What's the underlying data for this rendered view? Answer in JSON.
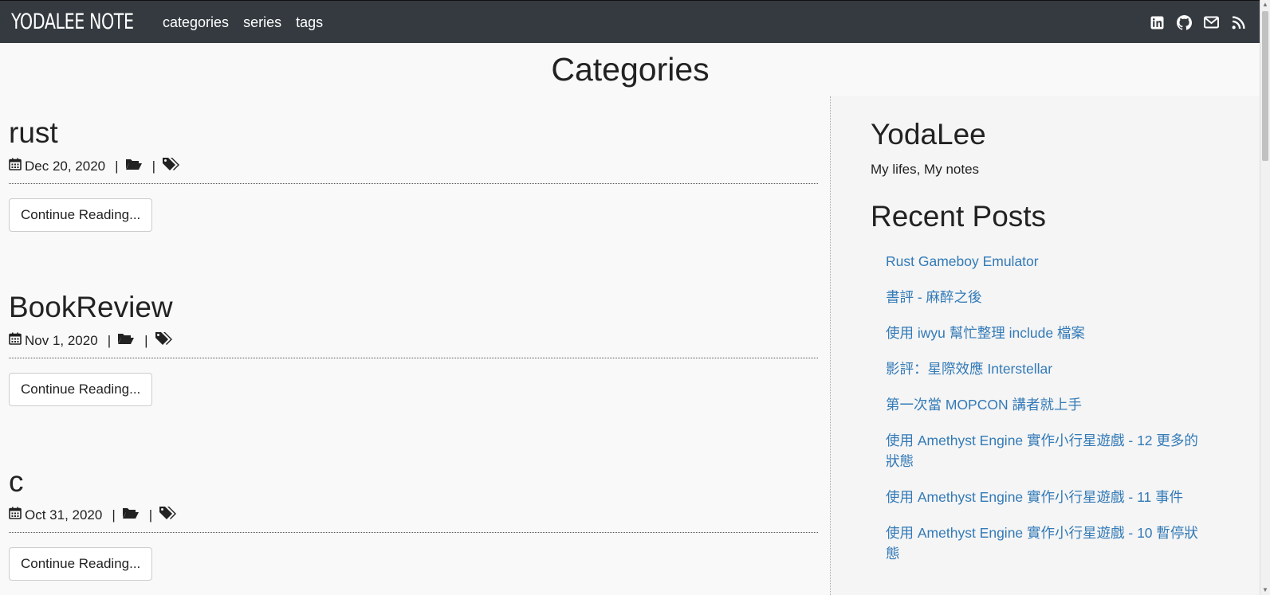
{
  "navbar": {
    "brand": "YODALEE NOTE",
    "links": [
      {
        "label": "categories"
      },
      {
        "label": "series"
      },
      {
        "label": "tags"
      }
    ],
    "social_icons": [
      "linkedin-icon",
      "github-icon",
      "envelope-icon",
      "rss-icon"
    ]
  },
  "page": {
    "title": "Categories"
  },
  "posts": [
    {
      "title": "rust",
      "date": "Dec 20, 2020",
      "button": "Continue Reading..."
    },
    {
      "title": "BookReview",
      "date": "Nov 1, 2020",
      "button": "Continue Reading..."
    },
    {
      "title": "c",
      "date": "Oct 31, 2020",
      "button": "Continue Reading..."
    }
  ],
  "meta_separator": "|",
  "sidebar": {
    "name": "YodaLee",
    "description": "My lifes, My notes",
    "recent_title": "Recent Posts",
    "recent_posts": [
      "Rust Gameboy Emulator",
      "書評 - 麻醉之後",
      "使用 iwyu 幫忙整理 include 檔案",
      "影評：星際效應 Interstellar",
      "第一次當 MOPCON 講者就上手",
      "使用 Amethyst Engine 實作小行星遊戲 - 12 更多的狀態",
      "使用 Amethyst Engine 實作小行星遊戲 - 11 事件",
      "使用 Amethyst Engine 實作小行星遊戲 - 10 暫停狀態"
    ]
  },
  "colors": {
    "navbar_bg": "#343a40",
    "link": "#337ab7",
    "page_bg": "#f9f9f9"
  }
}
